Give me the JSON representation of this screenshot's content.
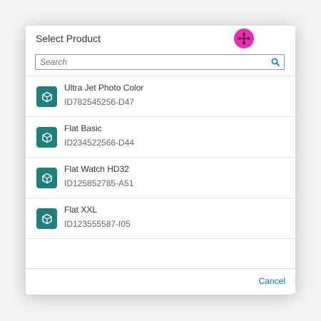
{
  "dialog": {
    "title": "Select Product",
    "move_icon": "move-arrows-icon",
    "resize_icon": "resize-grip-icon"
  },
  "search": {
    "placeholder": "Search",
    "value": "",
    "icon": "search-icon"
  },
  "items": [
    {
      "title": "Ultra Jet Photo Color",
      "id": "ID782545256-D47",
      "icon": "product-box-icon"
    },
    {
      "title": "Flat Basic",
      "id": "ID234522566-D44",
      "icon": "product-box-icon"
    },
    {
      "title": "Flat Watch HD32",
      "id": "ID125852785-A51",
      "icon": "product-box-icon"
    },
    {
      "title": "Flat XXL",
      "id": "ID123555587-I05",
      "icon": "product-box-icon"
    }
  ],
  "footer": {
    "cancel_label": "Cancel"
  },
  "colors": {
    "accent": "#0a6ed1",
    "icon_bg": "#1f7f7e",
    "move_handle": "#ea2bb3"
  }
}
